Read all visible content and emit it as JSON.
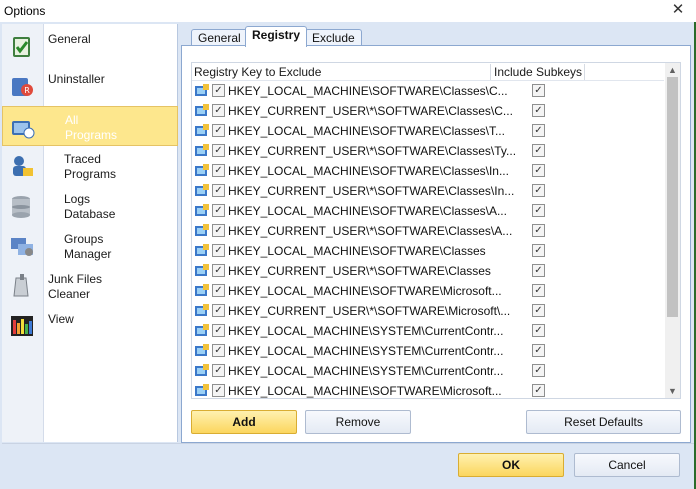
{
  "window": {
    "title": "Options",
    "close_glyph": "✕"
  },
  "sidebar": {
    "items": [
      {
        "label": "General",
        "icon": "general-check-icon"
      },
      {
        "label": "Uninstaller",
        "icon": "uninstaller-icon"
      },
      {
        "label": "All\nPrograms",
        "icon": "all-programs-icon",
        "active": true
      },
      {
        "label": "Traced\nPrograms",
        "icon": "traced-programs-icon"
      },
      {
        "label": "Logs\nDatabase",
        "icon": "logs-database-icon"
      },
      {
        "label": "Groups\nManager",
        "icon": "groups-manager-icon"
      },
      {
        "label": "Junk Files\nCleaner",
        "icon": "junk-files-icon"
      },
      {
        "label": "View",
        "icon": "view-icon"
      }
    ]
  },
  "tabs": [
    {
      "label": "General"
    },
    {
      "label": "Registry",
      "active": true
    },
    {
      "label": "Exclude"
    }
  ],
  "list": {
    "columns": {
      "key": "Registry Key to Exclude",
      "subkeys": "Include Subkeys"
    },
    "check_glyph": "✓",
    "rows": [
      {
        "key": "HKEY_LOCAL_MACHINE\\SOFTWARE\\Classes\\C...",
        "checked": true,
        "subkeys": true
      },
      {
        "key": "HKEY_CURRENT_USER\\*\\SOFTWARE\\Classes\\C...",
        "checked": true,
        "subkeys": true
      },
      {
        "key": "HKEY_LOCAL_MACHINE\\SOFTWARE\\Classes\\T...",
        "checked": true,
        "subkeys": true
      },
      {
        "key": "HKEY_CURRENT_USER\\*\\SOFTWARE\\Classes\\Ty...",
        "checked": true,
        "subkeys": true
      },
      {
        "key": "HKEY_LOCAL_MACHINE\\SOFTWARE\\Classes\\In...",
        "checked": true,
        "subkeys": true
      },
      {
        "key": "HKEY_CURRENT_USER\\*\\SOFTWARE\\Classes\\In...",
        "checked": true,
        "subkeys": true
      },
      {
        "key": "HKEY_LOCAL_MACHINE\\SOFTWARE\\Classes\\A...",
        "checked": true,
        "subkeys": true
      },
      {
        "key": "HKEY_CURRENT_USER\\*\\SOFTWARE\\Classes\\A...",
        "checked": true,
        "subkeys": true
      },
      {
        "key": "HKEY_LOCAL_MACHINE\\SOFTWARE\\Classes",
        "checked": true,
        "subkeys": true
      },
      {
        "key": "HKEY_CURRENT_USER\\*\\SOFTWARE\\Classes",
        "checked": true,
        "subkeys": true
      },
      {
        "key": "HKEY_LOCAL_MACHINE\\SOFTWARE\\Microsoft...",
        "checked": true,
        "subkeys": true
      },
      {
        "key": "HKEY_CURRENT_USER\\*\\SOFTWARE\\Microsoft\\...",
        "checked": true,
        "subkeys": true
      },
      {
        "key": "HKEY_LOCAL_MACHINE\\SYSTEM\\CurrentContr...",
        "checked": true,
        "subkeys": true
      },
      {
        "key": "HKEY_LOCAL_MACHINE\\SYSTEM\\CurrentContr...",
        "checked": true,
        "subkeys": true
      },
      {
        "key": "HKEY_LOCAL_MACHINE\\SYSTEM\\CurrentContr...",
        "checked": true,
        "subkeys": true
      },
      {
        "key": "HKEY_LOCAL_MACHINE\\SOFTWARE\\Microsoft...",
        "checked": true,
        "subkeys": true
      }
    ],
    "scroll_up_glyph": "▲",
    "scroll_down_glyph": "▼"
  },
  "buttons": {
    "add": "Add",
    "remove": "Remove",
    "reset": "Reset Defaults",
    "ok": "OK",
    "cancel": "Cancel"
  },
  "colors": {
    "accent_yellow": "#fde78d",
    "panel_blue": "#dce6f4",
    "tab_border": "#8ca8d0"
  }
}
